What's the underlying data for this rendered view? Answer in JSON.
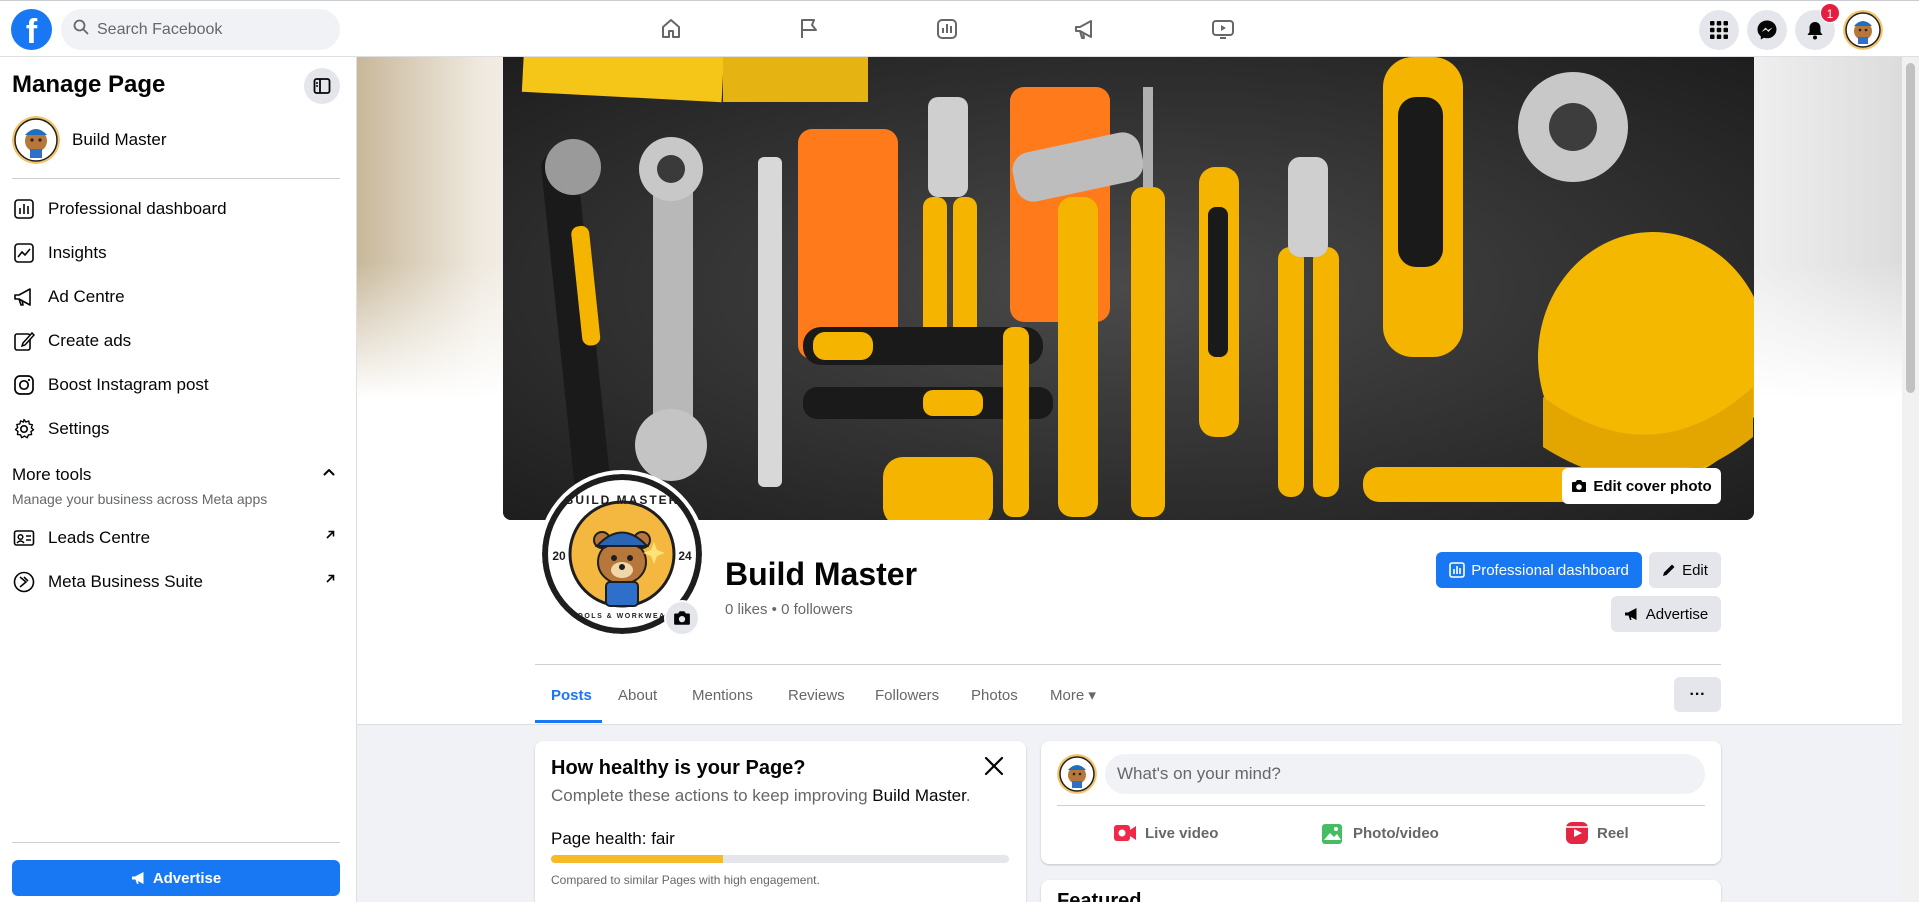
{
  "topbar": {
    "logo": "f",
    "search_placeholder": "Search Facebook",
    "nav_icons": [
      "home-icon",
      "pages-flag-icon",
      "insights-icon",
      "megaphone-icon",
      "video-icon"
    ],
    "right_icons": [
      "menu-grid-icon",
      "messenger-icon",
      "bell-icon"
    ],
    "notification_count": "1"
  },
  "sidebar": {
    "title": "Manage Page",
    "page_name": "Build Master",
    "items": [
      {
        "label": "Professional dashboard",
        "icon": "dashboard-icon"
      },
      {
        "label": "Insights",
        "icon": "insights-icon"
      },
      {
        "label": "Ad Centre",
        "icon": "megaphone-icon"
      },
      {
        "label": "Create ads",
        "icon": "pencil-icon"
      },
      {
        "label": "Boost Instagram post",
        "icon": "instagram-icon"
      },
      {
        "label": "Settings",
        "icon": "gear-icon"
      }
    ],
    "more_tools_title": "More tools",
    "more_tools_sub": "Manage your business across Meta apps",
    "tools": [
      {
        "label": "Leads Centre",
        "icon": "leads-icon"
      },
      {
        "label": "Meta Business Suite",
        "icon": "meta-icon"
      }
    ],
    "advertise_label": "Advertise"
  },
  "cover": {
    "edit_label": "Edit cover photo"
  },
  "profile": {
    "badge_text_top": "BUILD MASTER",
    "badge_text_bottom": "TOOLS & WORKWEAR",
    "badge_year_left": "20",
    "badge_year_right": "24",
    "name": "Build Master",
    "stats": "0 likes • 0 followers",
    "pro_dashboard_label": "Professional dashboard",
    "edit_label": "Edit",
    "advertise_label": "Advertise"
  },
  "tabs": [
    {
      "label": "Posts",
      "active": true
    },
    {
      "label": "About",
      "active": false
    },
    {
      "label": "Mentions",
      "active": false
    },
    {
      "label": "Reviews",
      "active": false
    },
    {
      "label": "Followers",
      "active": false
    },
    {
      "label": "Photos",
      "active": false
    },
    {
      "label": "More ▾",
      "active": false
    }
  ],
  "more_dots": "···",
  "health_card": {
    "title": "How healthy is your Page?",
    "subtitle_prefix": "Complete these actions to keep improving ",
    "subtitle_page": "Build Master",
    "subtitle_suffix": ".",
    "health_label": "Page health: fair",
    "health_progress": 0.375,
    "note": "Compared to similar Pages with high engagement."
  },
  "composer": {
    "placeholder": "What's on your mind?",
    "actions": [
      "Live video",
      "Photo/video",
      "Reel"
    ]
  },
  "featured": {
    "title": "Featured"
  },
  "colors": {
    "brand": "#1877f2",
    "health_bar": "#f7b928",
    "badge": "#e41e3f",
    "live": "#f02849",
    "photo": "#45bd62",
    "reel": "#e42645"
  }
}
